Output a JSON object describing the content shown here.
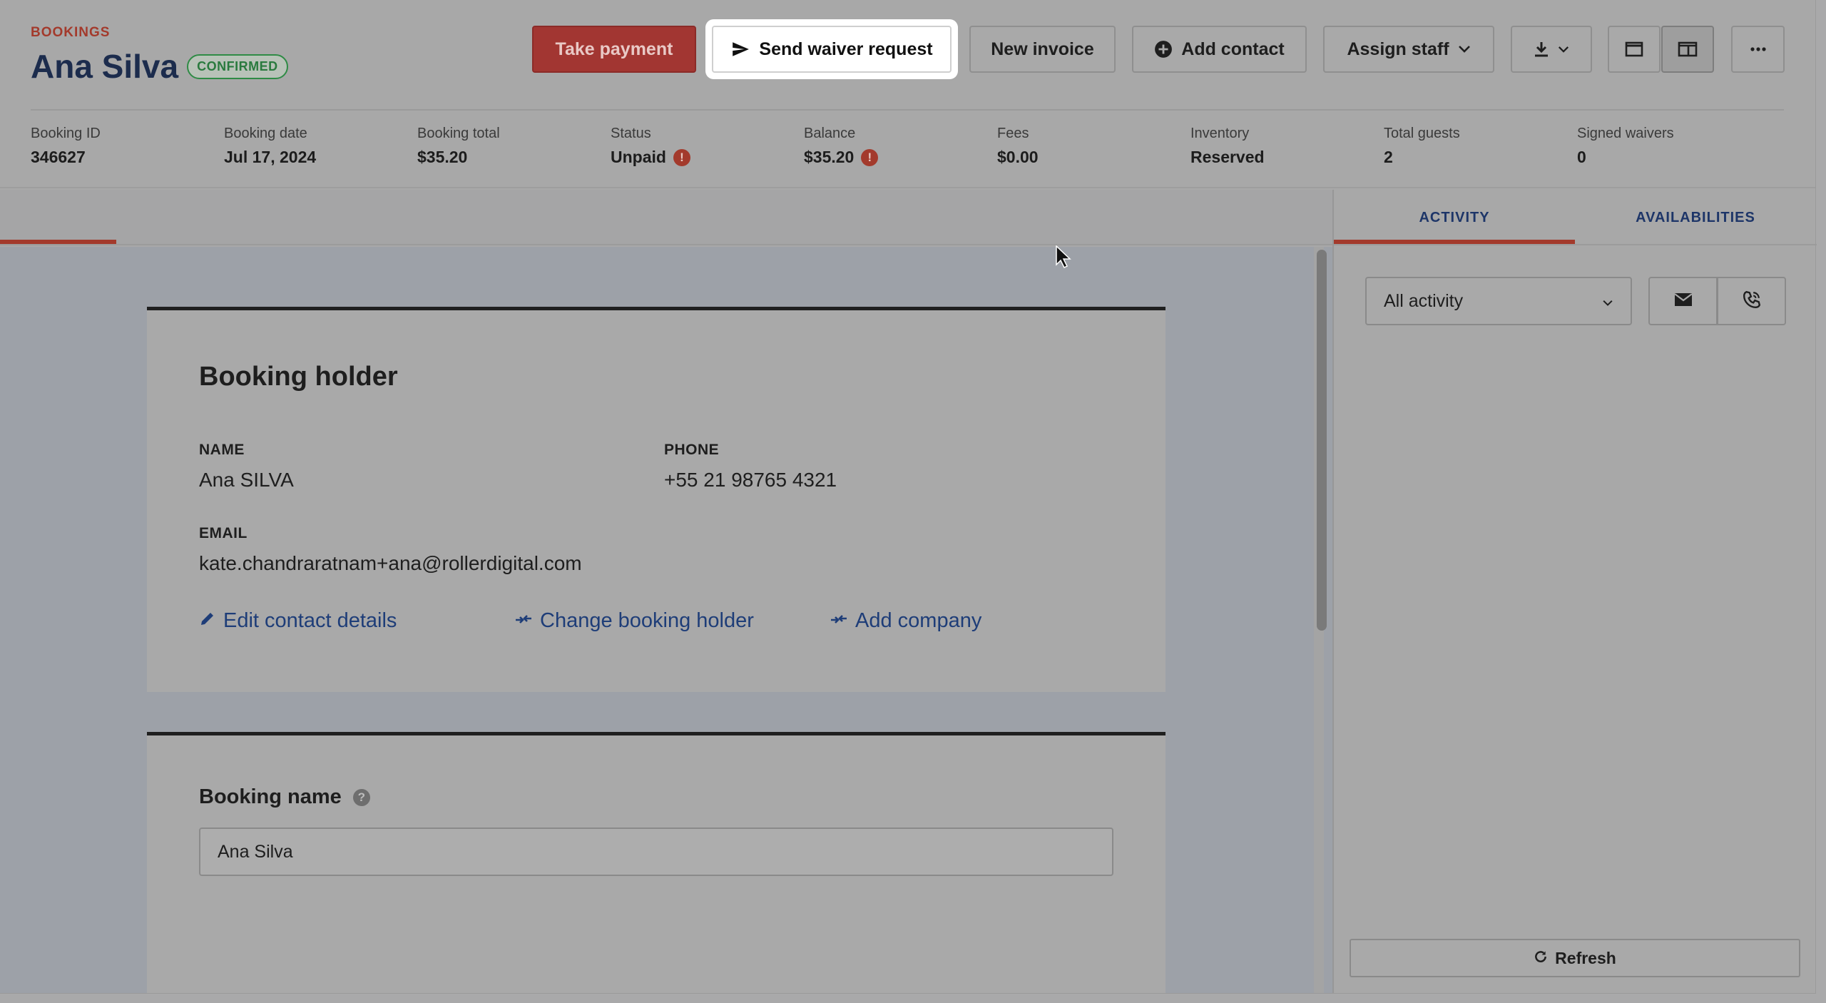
{
  "header": {
    "eyebrow": "BOOKINGS",
    "title": "Ana Silva",
    "status_badge": "CONFIRMED"
  },
  "toolbar": {
    "take_payment": "Take payment",
    "send_waiver": "Send waiver request",
    "new_invoice": "New invoice",
    "add_contact": "Add contact",
    "assign_staff": "Assign staff"
  },
  "stats": [
    {
      "label": "Booking ID",
      "value": "346627"
    },
    {
      "label": "Booking date",
      "value": "Jul 17, 2024"
    },
    {
      "label": "Booking total",
      "value": "$35.20"
    },
    {
      "label": "Status",
      "value": "Unpaid",
      "alert": "!"
    },
    {
      "label": "Balance",
      "value": "$35.20",
      "alert": "!"
    },
    {
      "label": "Fees",
      "value": "$0.00"
    },
    {
      "label": "Inventory",
      "value": "Reserved"
    },
    {
      "label": "Total guests",
      "value": "2"
    },
    {
      "label": "Signed waivers",
      "value": "0"
    }
  ],
  "booking_holder": {
    "title": "Booking holder",
    "name_label": "NAME",
    "name_value": "Ana SILVA",
    "phone_label": "PHONE",
    "phone_value": "+55 21 98765 4321",
    "email_label": "EMAIL",
    "email_value": "kate.chandraratnam+ana@rollerdigital.com",
    "edit_link": "Edit contact details",
    "change_link": "Change booking holder",
    "company_link": "Add company"
  },
  "booking_name": {
    "label": "Booking name",
    "help": "?",
    "value": "Ana Silva"
  },
  "right_panel": {
    "tab_activity": "ACTIVITY",
    "tab_availabilities": "AVAILABILITIES",
    "filter_selected": "All activity",
    "refresh": "Refresh"
  },
  "colors": {
    "accent_red": "#a33a2c",
    "link_blue": "#1e3d78",
    "title_navy": "#1c2c4d",
    "confirmed_green": "#2f8b45"
  }
}
